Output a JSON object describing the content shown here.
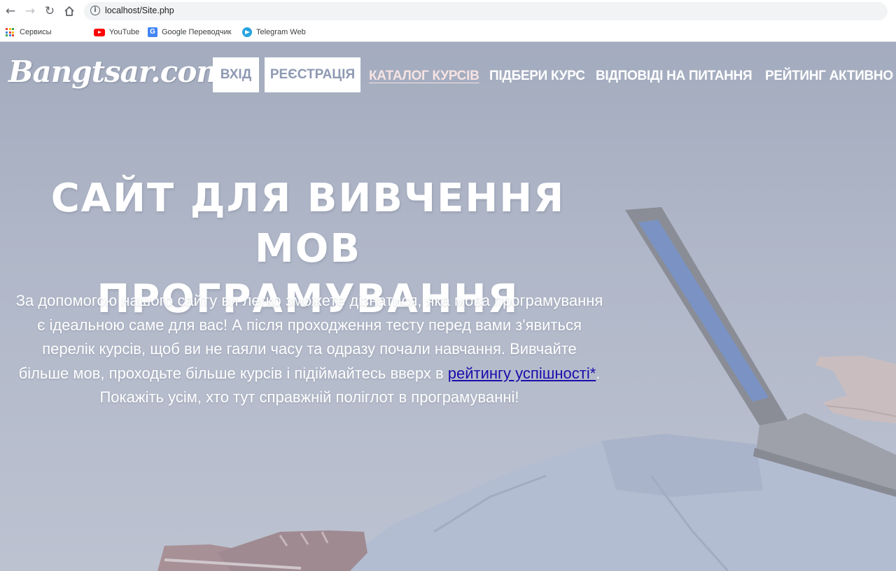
{
  "browser": {
    "url": "localhost/Site.php",
    "bookmarks": [
      {
        "label": "Сервисы",
        "icon": "apps-grid-icon"
      },
      {
        "label": "YouTube",
        "icon": "youtube-icon"
      },
      {
        "label": "Google Переводчик",
        "icon": "google-translate-icon"
      },
      {
        "label": "Telegram Web",
        "icon": "telegram-icon"
      }
    ]
  },
  "site": {
    "logo": "Bangtsar.com",
    "buttons": {
      "login": "ВХІД",
      "register": "РЕЄСТРАЦІЯ"
    },
    "nav": [
      {
        "label": "КАТАЛОГ КУРСІВ",
        "active": true
      },
      {
        "label": "ПІДБЕРИ КУРС"
      },
      {
        "label": "ВІДПОВІДІ НА ПИТАННЯ"
      },
      {
        "label": "РЕЙТИНГ АКТИВНО"
      }
    ],
    "hero": {
      "title_line1": "САЙТ ДЛЯ ВИВЧЕННЯ МОВ",
      "title_line2": "ПРОГРАМУВАННЯ",
      "text_before_link": "За допомогою нашого сайту ви легко зможете дізнатися, яка мова програмування є ідеальною саме для вас! А після проходження тесту перед вами з'явиться перелік курсів, щоб ви не гаяли часу та одразу почали навчання. Вивчайте більше мов, проходьте більше курсів і підіймайтесь вверх в ",
      "link_text": "рейтингу успішності*",
      "text_after_link": ". Покажіть усім, хто тут справжній поліглот в програмуванні!"
    }
  }
}
